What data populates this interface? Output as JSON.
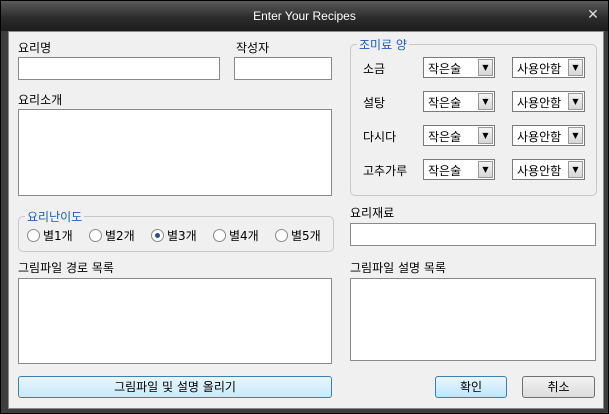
{
  "window": {
    "title": "Enter Your Recipes",
    "close_glyph": "✕"
  },
  "form": {
    "recipe_name_label": "요리명",
    "recipe_name_value": "",
    "author_label": "작성자",
    "author_value": "",
    "intro_label": "요리소개",
    "intro_value": ""
  },
  "difficulty": {
    "legend": "요리난이도",
    "options": [
      "별1개",
      "별2개",
      "별3개",
      "별4개",
      "별5개"
    ],
    "selected_index": 2
  },
  "seasoning": {
    "legend": "조미료 양",
    "rows": [
      {
        "name": "소금",
        "amount": "작은술",
        "usage": "사용안함"
      },
      {
        "name": "설탕",
        "amount": "작은술",
        "usage": "사용안함"
      },
      {
        "name": "다시다",
        "amount": "작은술",
        "usage": "사용안함"
      },
      {
        "name": "고추가루",
        "amount": "작은술",
        "usage": "사용안함"
      }
    ]
  },
  "ingredients": {
    "label": "요리재료",
    "value": ""
  },
  "image_paths": {
    "label": "그림파일 경로 목록"
  },
  "image_descriptions": {
    "label": "그림파일 설명 목록"
  },
  "buttons": {
    "upload": "그림파일 및 설명 올리기",
    "ok": "확인",
    "cancel": "취소"
  },
  "icons": {
    "combo_arrow": "▼"
  }
}
